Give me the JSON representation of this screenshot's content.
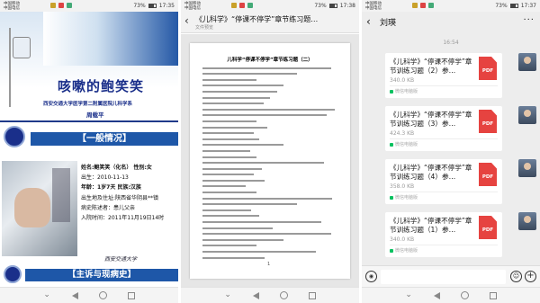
{
  "phone1": {
    "status": {
      "carrier1": "中国移动",
      "carrier2": "中国电信",
      "battery": "73%",
      "time": "17:35"
    },
    "slide1": {
      "title": "咳嗽的鲍笑笑",
      "institution": "西安交通大学医学第二附属医院儿科学系",
      "author": "周载平"
    },
    "slide2": {
      "heading": "【一般情况】",
      "lines": [
        "姓名:鲍笑笑（化名）   性别:女",
        "出生：2010-11-13",
        "年龄：1岁7天   民族:汉族",
        "出生地及住址:陕西省华阴县**镇",
        "病史陈述者：患儿父亲",
        "入院时间：2011年11月19日14时"
      ],
      "university": "西安交通大学"
    },
    "slide3": {
      "heading": "【主诉与现病史】"
    }
  },
  "phone2": {
    "status": {
      "carrier1": "中国移动",
      "carrier2": "中国电信",
      "battery": "73%",
      "time": "17:38"
    },
    "title": "《儿科学》“停课不停学”章节练习题…",
    "subtitle": "文件预览",
    "doc_title": "儿科学“停课不停学”章节练习题（二）",
    "page_number": "1"
  },
  "phone3": {
    "status": {
      "carrier1": "中国移动",
      "carrier2": "中国电信",
      "battery": "73%",
      "time": "17:37"
    },
    "contact": "刘瑛",
    "time": "16:54",
    "files": [
      {
        "name": "《儿科学》“停课不停学”章节训练习题（2）参…",
        "size": "340.0 KB"
      },
      {
        "name": "《儿科学》“停课不停学”章节训练习题（3）参…",
        "size": "424.3 KB"
      },
      {
        "name": "《儿科学》“停课不停学”章节训练习题（4）参…",
        "size": "358.0 KB"
      },
      {
        "name": "《儿科学》“停课不停学”章节训练习题（1）参…",
        "size": "340.0 KB"
      }
    ],
    "file_badge": "PDF",
    "source": "微信电脑版"
  },
  "colors": {
    "slide_blue": "#1e57a8",
    "wechat_green": "#07c160",
    "pdf_red": "#e64340"
  }
}
